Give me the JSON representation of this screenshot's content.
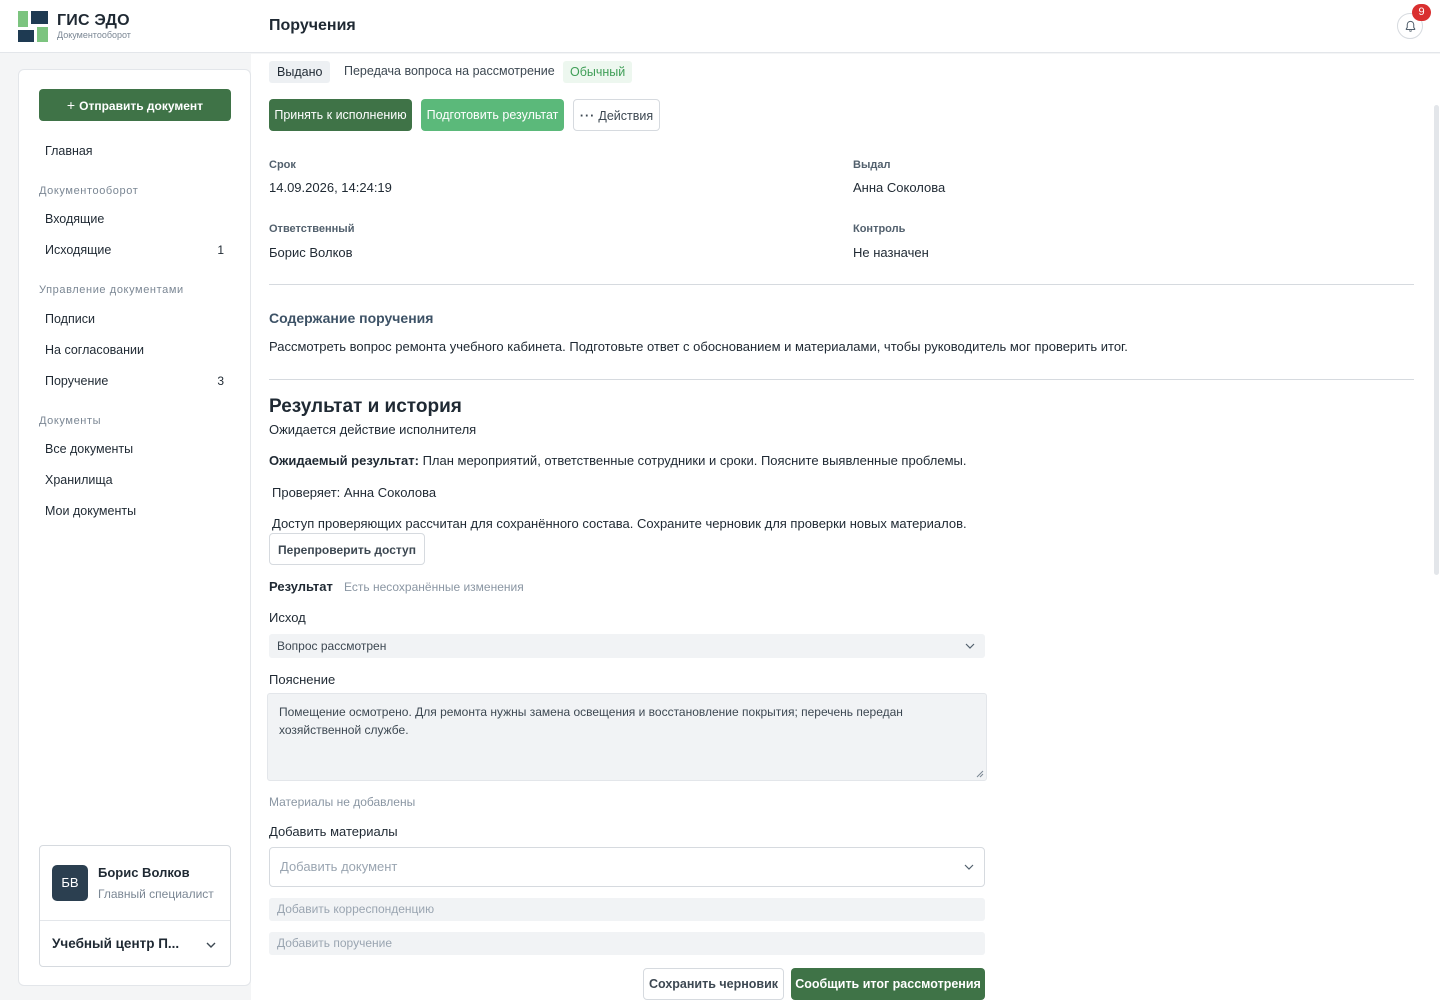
{
  "app": {
    "title": "ГИС ЭДО",
    "subtitle": "Документооборот"
  },
  "header": {
    "page_title": "Поручения",
    "notifications_count": "9"
  },
  "sidebar": {
    "send_button": "Отправить документ",
    "home": "Главная",
    "sections": [
      {
        "title": "Документооборот",
        "items": [
          {
            "label": "Входящие",
            "count": ""
          },
          {
            "label": "Исходящие",
            "count": "1"
          }
        ]
      },
      {
        "title": "Управление документами",
        "items": [
          {
            "label": "Подписи",
            "count": ""
          },
          {
            "label": "На согласовании",
            "count": ""
          },
          {
            "label": "Поручение",
            "count": "3"
          }
        ]
      },
      {
        "title": "Документы",
        "items": [
          {
            "label": "Все документы",
            "count": ""
          },
          {
            "label": "Хранилища",
            "count": ""
          },
          {
            "label": "Мои документы",
            "count": ""
          }
        ]
      }
    ],
    "user": {
      "initials": "БВ",
      "name": "Борис Волков",
      "role": "Главный специалист",
      "organization": "Учебный центр П..."
    }
  },
  "task": {
    "status": "Выдано",
    "type": "Передача вопроса на рассмотрение",
    "priority": "Обычный",
    "actions": {
      "accept": "Принять к исполнению",
      "prepare": "Подготовить результат",
      "more": "Действия"
    },
    "fields": {
      "deadline_label": "Срок",
      "deadline_value": "14.09.2026, 14:24:19",
      "issued_by_label": "Выдал",
      "issued_by_value": "Анна Соколова",
      "responsible_label": "Ответственный",
      "responsible_value": "Борис Волков",
      "control_label": "Контроль",
      "control_value": "Не назначен"
    },
    "content_heading": "Содержание поручения",
    "content_text": "Рассмотреть вопрос ремонта учебного кабинета. Подготовьте ответ с обоснованием и материалами, чтобы руководитель мог проверить итог."
  },
  "result": {
    "heading": "Результат и история",
    "status": "Ожидается действие исполнителя",
    "expected_label": "Ожидаемый результат:",
    "expected_text": " План мероприятий, ответственные сотрудники и сроки. Поясните выявленные проблемы.",
    "reviewer": "Проверяет: Анна Соколова",
    "access_note": "Доступ проверяющих рассчитан для сохранённого состава. Сохраните черновик для проверки новых материалов.",
    "recheck_button": "Перепроверить доступ",
    "form_title": "Результат",
    "unsaved_note": "Есть несохранённые изменения",
    "outcome_label": "Исход",
    "outcome_value": "Вопрос рассмотрен",
    "explanation_label": "Пояснение",
    "explanation_value": "Помещение осмотрено. Для ремонта нужны замена освещения и восстановление покрытия; перечень передан хозяйственной службе.",
    "materials_none": "Материалы не добавлены",
    "add_materials_label": "Добавить материалы",
    "add_document_placeholder": "Добавить документ",
    "add_correspondence_placeholder": "Добавить корреспонденцию",
    "add_task_placeholder": "Добавить поручение",
    "save_draft_button": "Сохранить черновик",
    "report_button": "Сообщить итог рассмотрения"
  },
  "colors": {
    "primary": "#3f7347",
    "secondary_green": "#5bb97a",
    "badge_red": "#d92f2f",
    "avatar_bg": "#2b3f50"
  }
}
